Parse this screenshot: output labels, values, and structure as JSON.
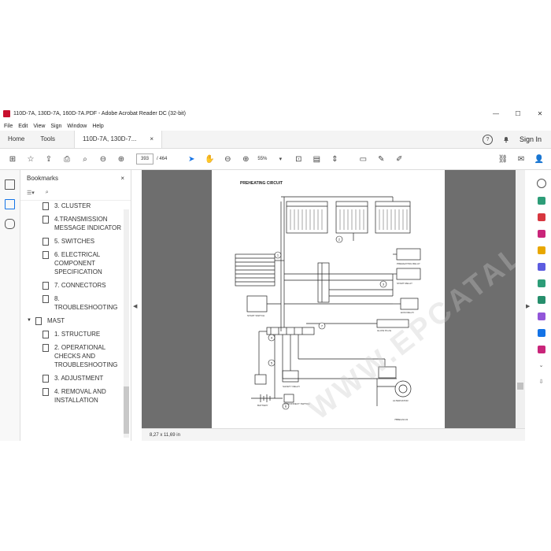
{
  "window": {
    "title": "110D-7A, 130D-7A, 160D-7A.PDF - Adobe Acrobat Reader DC (32-bit)"
  },
  "menu": [
    "File",
    "Edit",
    "View",
    "Sign",
    "Window",
    "Help"
  ],
  "tabs": {
    "home": "Home",
    "tools": "Tools",
    "doc": "110D-7A, 130D-7...",
    "close": "×"
  },
  "header": {
    "help": "?",
    "sign_in": "Sign In"
  },
  "toolbar": {
    "page_current": "393",
    "page_total": "/ 464",
    "zoom": "55%"
  },
  "bookmarks": {
    "title": "Bookmarks",
    "close": "×",
    "items": [
      {
        "label": "3. CLUSTER",
        "level": 2
      },
      {
        "label": "4.TRANSMISSION MESSAGE INDICATOR",
        "level": 2
      },
      {
        "label": "5. SWITCHES",
        "level": 2
      },
      {
        "label": "6. ELECTRICAL COMPONENT SPECIFICATION",
        "level": 2
      },
      {
        "label": "7. CONNECTORS",
        "level": 2
      },
      {
        "label": "8. TROUBLESHOOTING",
        "level": 2
      },
      {
        "label": "MAST",
        "level": 1
      },
      {
        "label": "1. STRUCTURE",
        "level": 2
      },
      {
        "label": "2. OPERATIONAL CHECKS AND TROUBLESHOOTING",
        "level": 2
      },
      {
        "label": "3. ADJUSTMENT",
        "level": 2
      },
      {
        "label": "4. REMOVAL AND INSTALLATION",
        "level": 2
      }
    ]
  },
  "document": {
    "heading": "PREHEATING CIRCUIT",
    "watermark": "WWW.EPCATALOGS.COM",
    "labels": {
      "preheating_relay": "PREHEATING RELAY",
      "start_relay": "START RELAY",
      "ecm_relay": "ECM RELAY",
      "glow_plug": "GLOW PLUG",
      "alternator": "ALTERNATOR",
      "battery": "BATTERY",
      "start_switch": "START SWITCH",
      "safety_relay": "SAFETY RELAY",
      "disconnect": "DISCONNECT SWITCH",
      "code": "7BBE1A0-01"
    },
    "callouts": [
      "1",
      "2",
      "3",
      "4",
      "5",
      "6",
      "7"
    ]
  },
  "status": {
    "size": "8,27 x 11,69 in"
  },
  "colors": {
    "accent": "#1473e6",
    "pdf_red": "#c8102e",
    "viewer_bg": "#6e6e6e"
  }
}
